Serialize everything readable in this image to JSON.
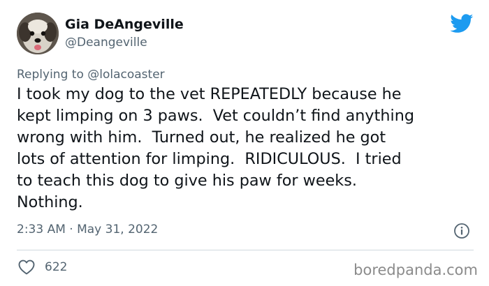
{
  "tweet": {
    "author_name": "Gia DeAngeville",
    "author_handle": "@Deangeville",
    "replying_to": "Replying to @lolacoaster",
    "text": "I took my dog to the vet REPEATEDLY because he\nkept limping on 3 paws.  Vet couldn’t find anything\nwrong with him.  Turned out, he realized he got\nlots of attention for limping.  RIDICULOUS.  I tried\nto teach this dog to give his paw for weeks.\nNothing.",
    "timestamp": "2:33 AM · May 31, 2022",
    "like_count": "622"
  },
  "watermark": "boredpanda.com",
  "icons": {
    "brand": "twitter-bird-icon",
    "info": "info-icon",
    "like": "heart-icon"
  },
  "colors": {
    "twitter_blue": "#1d9bf0",
    "secondary_text": "#536471",
    "primary_text": "#0f1419"
  }
}
